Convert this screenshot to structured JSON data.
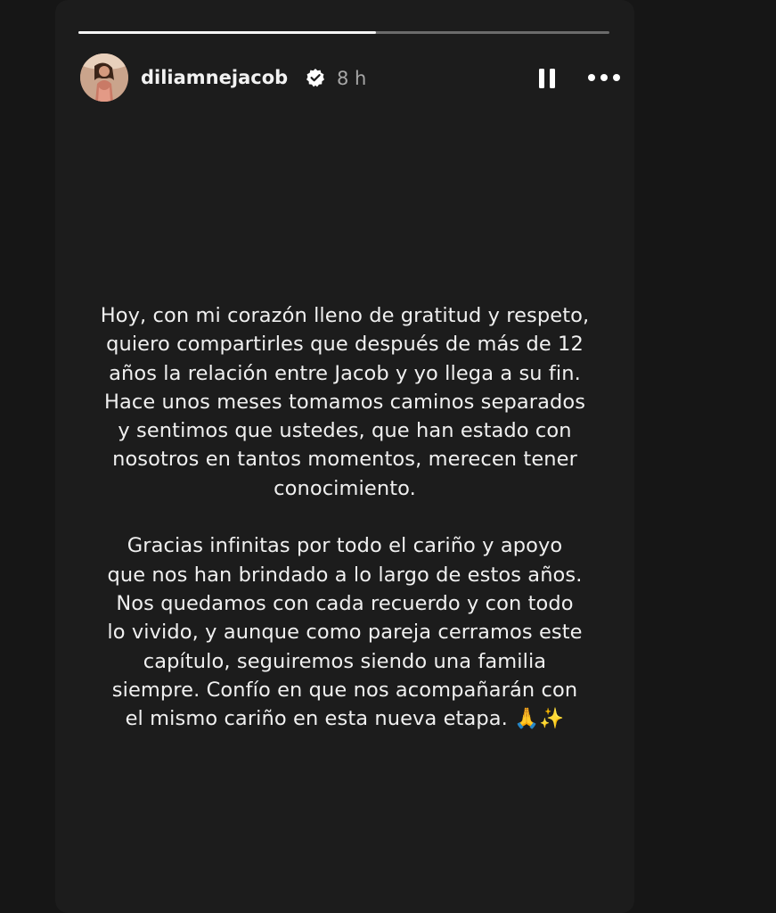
{
  "story": {
    "progress": 0.56,
    "username": "diliamnejacob",
    "time_ago": "8 h",
    "verified": true,
    "paragraphs": [
      [
        "Hoy, con mi corazón lleno de gratitud y respeto,",
        "quiero compartirles que después de más de 12",
        "años la relación entre Jacob y yo llega a su fin.",
        "Hace unos meses tomamos caminos separados",
        "y sentimos que ustedes, que han estado con",
        "nosotros en tantos momentos, merecen tener",
        "conocimiento."
      ],
      [
        "Gracias infinitas por todo el cariño y apoyo",
        "que nos han brindado a lo largo de estos años.",
        "Nos quedamos con cada recuerdo y con todo",
        "lo vivido, y aunque como pareja cerramos este",
        "capítulo, seguiremos siendo una familia",
        "siempre. Confío en que nos acompañarán con",
        "el mismo cariño en esta nueva etapa."
      ]
    ],
    "emoji_pray": "🙏",
    "emoji_sparkles": "✨"
  },
  "icons": {
    "verified": "verified-badge-icon",
    "pause": "pause-icon",
    "more": "more-options-icon"
  },
  "colors": {
    "background": "#161616",
    "card": "#1c1c1c",
    "text": "#f0f0f0",
    "muted": "#a7a7a7",
    "verified_badge": "#ffffff"
  }
}
